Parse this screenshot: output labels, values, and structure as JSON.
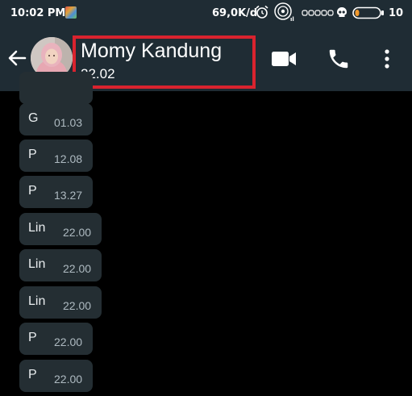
{
  "status_bar": {
    "time": "10:02 PM",
    "network_speed": "69,0K/d",
    "battery_level": "10",
    "icons": [
      "app-icon",
      "alarm-icon",
      "disc-icon",
      "signal-icon",
      "skull-icon",
      "battery-icon"
    ]
  },
  "header": {
    "contact_name": "Momy Kandung",
    "last_seen": "22.02",
    "highlight_color": "#d9232e",
    "icons": [
      "back-arrow-icon",
      "video-call-icon",
      "phone-call-icon",
      "more-options-icon"
    ]
  },
  "messages": [
    {
      "text": "",
      "time": ""
    },
    {
      "text": "G",
      "time": "01.03"
    },
    {
      "text": "P",
      "time": "12.08"
    },
    {
      "text": "P",
      "time": "13.27"
    },
    {
      "text": "Lin",
      "time": "22.00"
    },
    {
      "text": "Lin",
      "time": "22.00"
    },
    {
      "text": "Lin",
      "time": "22.00"
    },
    {
      "text": "P",
      "time": "22.00"
    },
    {
      "text": "P",
      "time": "22.00"
    }
  ],
  "colors": {
    "header_bg": "#1f2c34",
    "chat_bg": "#000000",
    "bubble_bg": "#242e33"
  }
}
